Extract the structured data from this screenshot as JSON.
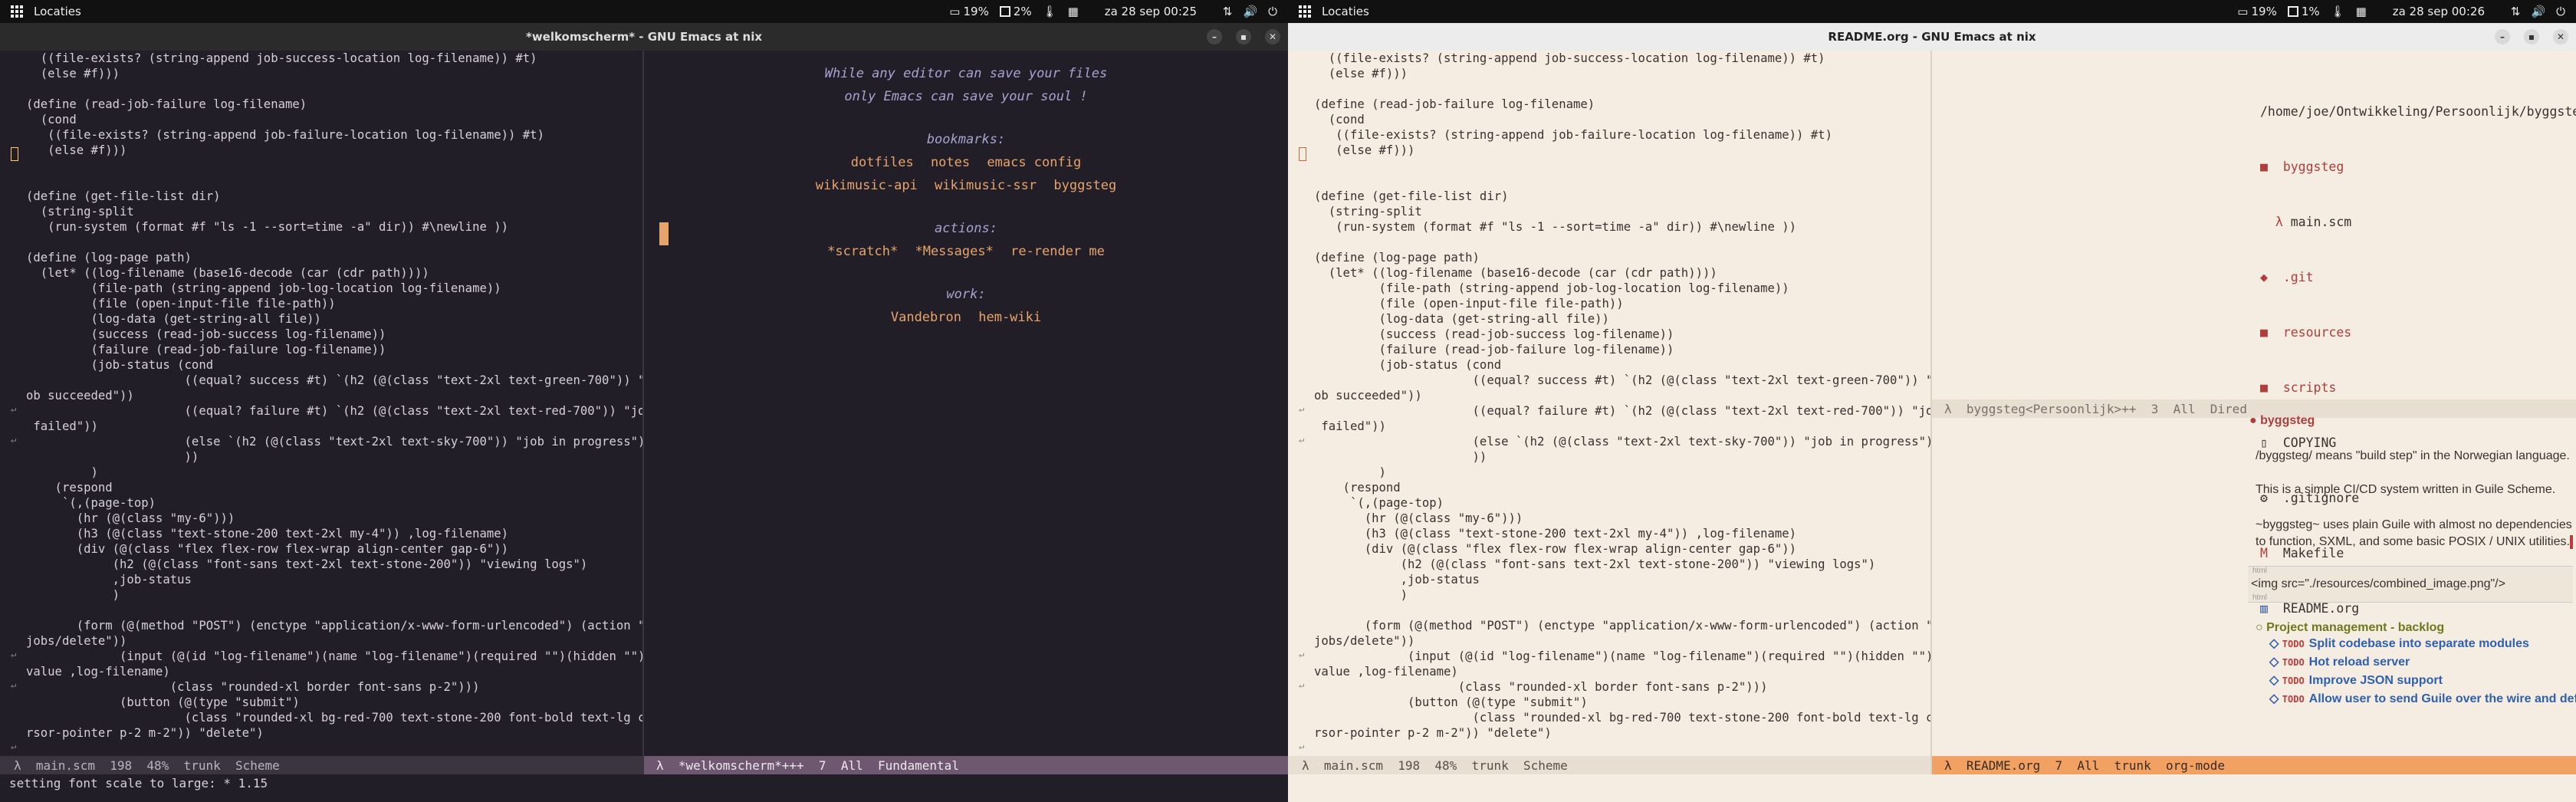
{
  "left_screen": {
    "topbar": {
      "workspace": "Locaties",
      "battery": "19%",
      "cpu": "2%",
      "date": "za 28 sep",
      "time": "00:25"
    },
    "window_title": "*welkomscherm* - GNU Emacs at nix",
    "code_lines": [
      "  ((file-exists? (string-append job-success-location log-filename)) #t)",
      "  (else #f)))",
      "",
      "(define (read-job-failure log-filename)",
      "  (cond",
      "   ((file-exists? (string-append job-failure-location log-filename)) #t)",
      "   (else #f)))",
      "",
      "",
      "(define (get-file-list dir)",
      "  (string-split",
      "   (run-system (format #f \"ls -1 --sort=time -a\" dir)) #\\newline ))",
      "",
      "(define (log-page path)",
      "  (let* ((log-filename (base16-decode (car (cdr path))))",
      "         (file-path (string-append job-log-location log-filename))",
      "         (file (open-input-file file-path))",
      "         (log-data (get-string-all file))",
      "         (success (read-job-success log-filename))",
      "         (failure (read-job-failure log-filename))",
      "         (job-status (cond",
      "                      ((equal? success #t) `(h2 (@(class \"text-2xl text-green-700\")) \"j",
      "ob succeeded\"))",
      "                      ((equal? failure #t) `(h2 (@(class \"text-2xl text-red-700\")) \"job",
      " failed\"))",
      "                      (else `(h2 (@(class \"text-2xl text-sky-700\")) \"job in progress\"))",
      "                      ))",
      "         )",
      "    (respond",
      "     `(,(page-top)",
      "       (hr (@(class \"my-6\")))",
      "       (h3 (@(class \"text-stone-200 text-2xl my-4\")) ,log-filename)",
      "       (div (@(class \"flex flex-row flex-wrap align-center gap-6\"))",
      "            (h2 (@(class \"font-sans text-2xl text-stone-200\")) \"viewing logs\")",
      "            ,job-status",
      "            )",
      "",
      "       (form (@(method \"POST\") (enctype \"application/x-www-form-urlencoded\") (action \"/",
      "jobs/delete\"))",
      "             (input (@(id \"log-filename\")(name \"log-filename\")(required \"\")(hidden \"\")(",
      "value ,log-filename)",
      "                    (class \"rounded-xl border font-sans p-2\")))",
      "             (button (@(type \"submit\")",
      "                      (class \"rounded-xl bg-red-700 text-stone-200 font-bold text-lg cu",
      "rsor-pointer p-2 m-2\")) \"delete\")"
    ],
    "modeline_left": "λ  main.scm  198  48%  trunk  Scheme",
    "dashboard": {
      "quote1": "While any editor can save your files",
      "quote2": "only Emacs can save your soul !",
      "bookmarks_heading": "bookmarks:",
      "bookmarks_row1": [
        "dotfiles",
        "notes",
        "emacs config"
      ],
      "bookmarks_row2": [
        "wikimusic-api",
        "wikimusic-ssr",
        "byggsteg"
      ],
      "actions_heading": "actions:",
      "actions": [
        "*scratch*",
        "*Messages*",
        "re-render me"
      ],
      "work_heading": "work:",
      "work": [
        "Vandebron",
        "hem-wiki"
      ]
    },
    "modeline_right": "λ  *welkomscherm*+++  7  All  Fundamental",
    "echo": "setting font scale to large: * 1.15"
  },
  "right_screen": {
    "topbar": {
      "workspace": "Locaties",
      "battery": "19%",
      "cpu": "1%",
      "date": "za 28 sep",
      "time": "00:26"
    },
    "window_title": "README.org - GNU Emacs at nix",
    "modeline_left": "λ  main.scm  198  48%  trunk  Scheme",
    "dired": {
      "path": "/home/joe/Ontwikkeling/Persoonlijk/byggsteg:",
      "entries": [
        {
          "icon": "folder-icon",
          "name": "byggsteg"
        },
        {
          "icon": "lambda-icon",
          "name": "main.scm"
        },
        {
          "icon": "git-icon",
          "name": ".git"
        },
        {
          "icon": "folder-icon",
          "name": "resources"
        },
        {
          "icon": "folder-icon",
          "name": "scripts"
        },
        {
          "icon": "file-icon",
          "name": "COPYING"
        },
        {
          "icon": "gear-icon",
          "name": ".gitignore"
        },
        {
          "icon": "makefile-icon",
          "name": "Makefile"
        },
        {
          "icon": "book-icon",
          "name": "README.org"
        }
      ]
    },
    "dired_modeline": "λ  byggsteg<Persoonlijk>++  3  All  Dired",
    "org": {
      "heading": "byggsteg",
      "p1": "/byggsteg/ means \"build step\" in the Norwegian language.",
      "p2": "This is a simple CI/CD system written in Guile Scheme.",
      "p3": "~byggsteg~ uses plain Guile with almost no dependencies to function, SXML, and some basic POSIX / UNIX utilities.",
      "html_label": "html",
      "html_content": "<img src=\"./resources/combined_image.png\"/>",
      "backlog_heading": "Project management - backlog",
      "todo_keyword": "TODO",
      "todos": [
        "Split codebase into separate modules",
        "Hot reload server",
        "Improve JSON support",
        "Allow user to send Guile over the wire and define his/her own pipeline in a"
      ]
    },
    "org_modeline": "λ  README.org  7  All  trunk  org-mode"
  }
}
